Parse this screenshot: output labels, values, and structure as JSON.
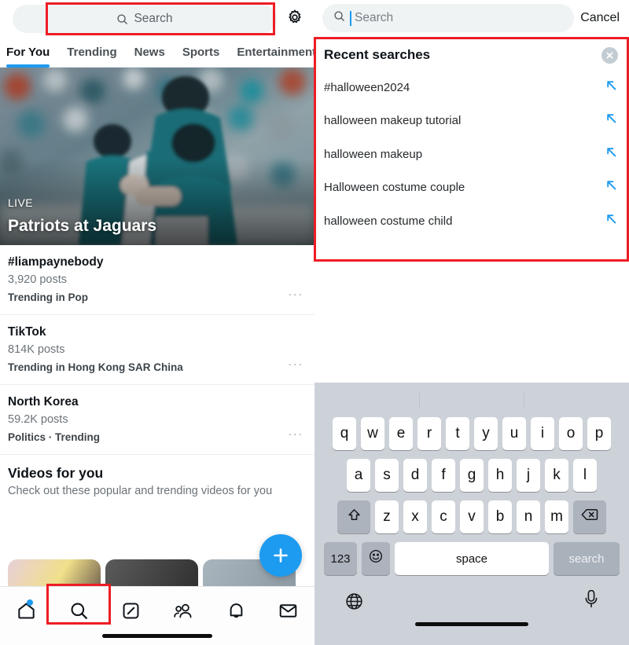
{
  "left": {
    "search": {
      "placeholder": "Search",
      "icon": "search-icon"
    },
    "settings_icon": "gear-icon",
    "tabs": [
      {
        "label": "For You",
        "active": true
      },
      {
        "label": "Trending",
        "active": false
      },
      {
        "label": "News",
        "active": false
      },
      {
        "label": "Sports",
        "active": false
      },
      {
        "label": "Entertainment",
        "active": false
      }
    ],
    "hero": {
      "badge": "LIVE",
      "title": "Patriots at Jaguars"
    },
    "trends": [
      {
        "name": "#liampaynebody",
        "posts": "3,920 posts",
        "category": "Trending in Pop",
        "more": "···"
      },
      {
        "name": "TikTok",
        "posts": "814K posts",
        "category": "Trending in Hong Kong SAR China",
        "more": "···"
      },
      {
        "name": "North Korea",
        "posts": "59.2K posts",
        "category": "Politics · Trending",
        "more": "···"
      }
    ],
    "videos": {
      "title": "Videos for you",
      "subtitle": "Check out these popular and trending videos for you"
    },
    "fab": {
      "label": "+",
      "color": "#1d9bf0"
    },
    "nav": [
      {
        "name": "home-icon",
        "badge": true
      },
      {
        "name": "search-icon",
        "badge": false
      },
      {
        "name": "grok-icon",
        "badge": false
      },
      {
        "name": "communities-icon",
        "badge": false
      },
      {
        "name": "notifications-icon",
        "badge": false
      },
      {
        "name": "messages-icon",
        "badge": false
      }
    ]
  },
  "right": {
    "search": {
      "placeholder": "Search",
      "value": "",
      "icon": "search-icon"
    },
    "cancel_label": "Cancel",
    "recent": {
      "title": "Recent searches",
      "clear_icon": "close-circle-icon",
      "items": [
        {
          "text": "#halloween2024",
          "icon": "arrow-up-left-icon"
        },
        {
          "text": "halloween makeup tutorial",
          "icon": "arrow-up-left-icon"
        },
        {
          "text": "halloween makeup",
          "icon": "arrow-up-left-icon"
        },
        {
          "text": "Halloween costume couple",
          "icon": "arrow-up-left-icon"
        },
        {
          "text": "halloween costume child",
          "icon": "arrow-up-left-icon"
        }
      ]
    },
    "keyboard": {
      "row1": [
        "q",
        "w",
        "e",
        "r",
        "t",
        "y",
        "u",
        "i",
        "o",
        "p"
      ],
      "row2": [
        "a",
        "s",
        "d",
        "f",
        "g",
        "h",
        "j",
        "k",
        "l"
      ],
      "row3": [
        "z",
        "x",
        "c",
        "v",
        "b",
        "n",
        "m"
      ],
      "shift_icon": "shift-icon",
      "backspace_icon": "backspace-icon",
      "numbers_label": "123",
      "emoji_icon": "emoji-icon",
      "space_label": "space",
      "enter_label": "search",
      "globe_icon": "globe-icon",
      "mic_icon": "microphone-icon"
    }
  },
  "annotations": {
    "colors": {
      "highlight": "#ee1d24",
      "accent": "#1d9bf0"
    },
    "boxes": [
      "left-search-bar",
      "recent-searches-panel",
      "bottom-nav-search-tab"
    ]
  }
}
